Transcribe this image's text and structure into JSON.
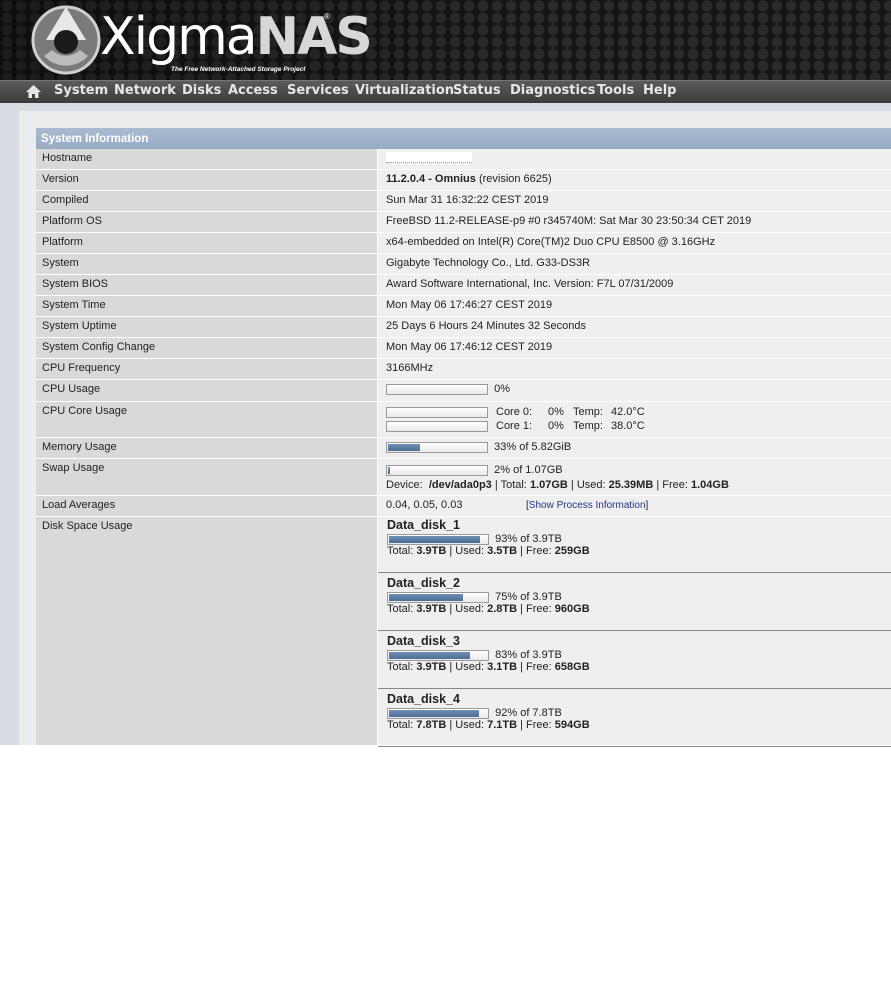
{
  "header": {
    "logo_text_a": "Xigma",
    "logo_text_b": "NAS",
    "logo_reg": "®",
    "tagline": "The Free Network-Attached Storage Project"
  },
  "nav": [
    "System",
    "Network",
    "Disks",
    "Access",
    "Services",
    "Virtualization",
    "Status",
    "Diagnostics",
    "Tools",
    "Help"
  ],
  "panel": {
    "title": "System Information"
  },
  "labels": {
    "hostname": "Hostname",
    "version": "Version",
    "compiled": "Compiled",
    "platform_os": "Platform OS",
    "platform": "Platform",
    "system": "System",
    "bios": "System BIOS",
    "time": "System Time",
    "uptime": "System Uptime",
    "config": "System Config Change",
    "cpu_freq": "CPU Frequency",
    "cpu_usage": "CPU Usage",
    "core_usage": "CPU Core Usage",
    "mem_usage": "Memory Usage",
    "swap_usage": "Swap Usage",
    "load": "Load Averages",
    "disk_usage": "Disk Space Usage"
  },
  "values": {
    "version_bold": "11.2.0.4 - Omnius",
    "version_rest": "(revision 6625)",
    "compiled": "Sun Mar 31 16:32:22 CEST 2019",
    "platform_os": "FreeBSD 11.2-RELEASE-p9 #0 r345740M: Sat Mar 30 23:50:34 CET 2019",
    "platform": "x64-embedded on Intel(R) Core(TM)2 Duo CPU E8500 @ 3.16GHz",
    "system": "Gigabyte Technology Co., Ltd. G33-DS3R",
    "bios": "Award Software International, Inc. Version: F7L 07/31/2009",
    "time": "Mon May 06 17:46:27 CEST 2019",
    "uptime": "25 Days 6 Hours 24 Minutes 32 Seconds",
    "config": "Mon May 06 17:46:12 CEST 2019",
    "cpu_freq": "3166MHz",
    "cpu_usage_text": "0%",
    "cpu_usage_pct": 0,
    "cores": [
      {
        "label": "Core 0:",
        "pct": "0%",
        "temp_label": "Temp:",
        "temp": "42.0°C",
        "pct_value": 0
      },
      {
        "label": "Core 1:",
        "pct": "0%",
        "temp_label": "Temp:",
        "temp": "38.0°C",
        "pct_value": 0
      }
    ],
    "mem_text": "33% of 5.82GiB",
    "mem_pct": 33,
    "swap_text": "2% of 1.07GB",
    "swap_pct": 2,
    "swap_device_label": "Device:",
    "swap_device": "/dev/ada0p3",
    "swap_total_label": "| Total:",
    "swap_total": "1.07GB",
    "swap_used_label": "| Used:",
    "swap_used": "25.39MB",
    "swap_free_label": "| Free:",
    "swap_free": "1.04GB",
    "load": "0.04, 0.05, 0.03",
    "process_link": "Show Process Information",
    "bracket_open": "[",
    "bracket_close": "]"
  },
  "disks": [
    {
      "name": "Data_disk_1",
      "pct": 93,
      "usage": "93% of 3.9TB",
      "total": "3.9TB",
      "used": "3.5TB",
      "free": "259GB"
    },
    {
      "name": "Data_disk_2",
      "pct": 75,
      "usage": "75% of 3.9TB",
      "total": "3.9TB",
      "used": "2.8TB",
      "free": "960GB"
    },
    {
      "name": "Data_disk_3",
      "pct": 83,
      "usage": "83% of 3.9TB",
      "total": "3.9TB",
      "used": "3.1TB",
      "free": "658GB"
    },
    {
      "name": "Data_disk_4",
      "pct": 92,
      "usage": "92% of 7.8TB",
      "total": "7.8TB",
      "used": "7.1TB",
      "free": "594GB"
    }
  ],
  "disk_labels": {
    "total": "Total:",
    "used": "| Used:",
    "free": "| Free:"
  },
  "colors": {
    "bar_fill": "#4b6f97",
    "panel_title": "#a9bbd0",
    "navbar": "#3b3b3b"
  }
}
